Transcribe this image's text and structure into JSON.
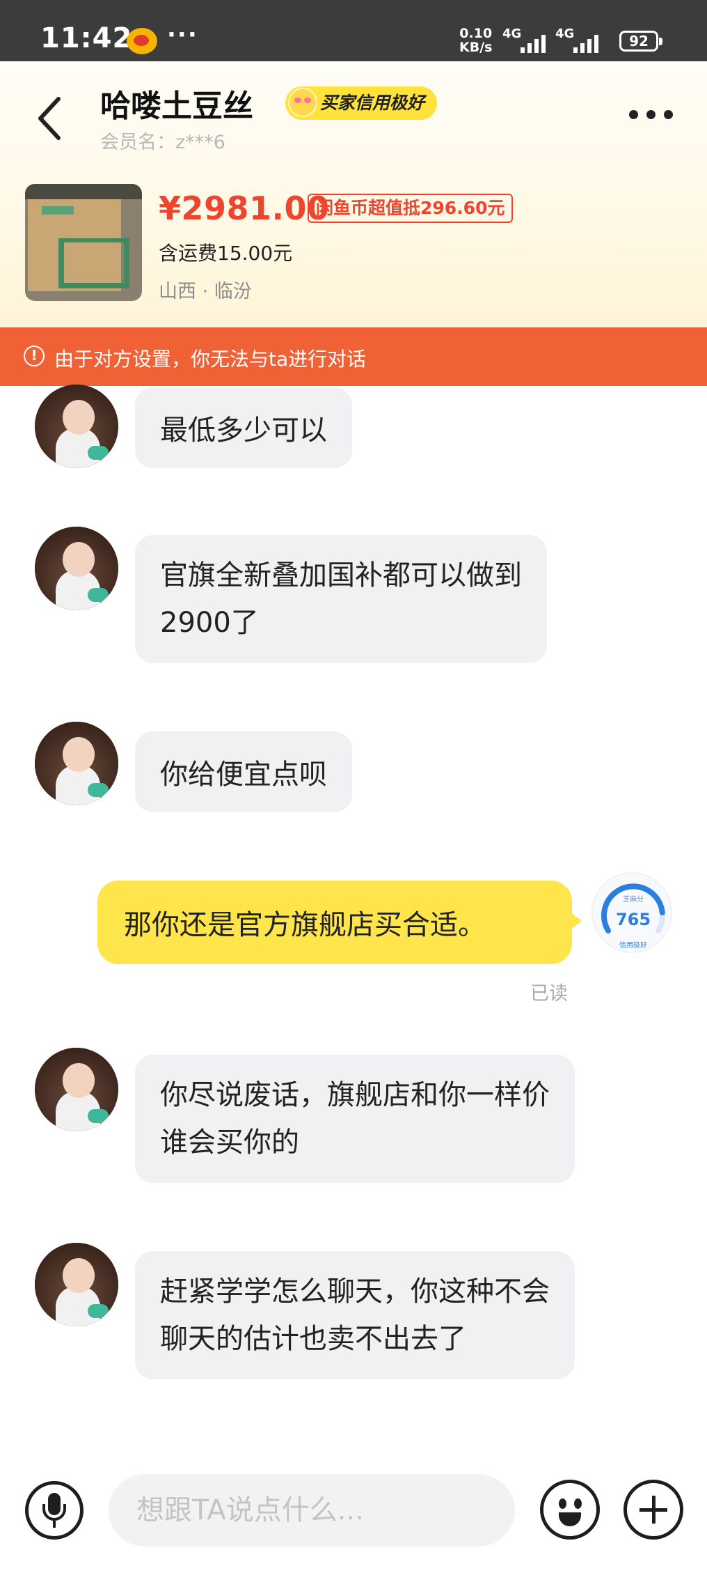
{
  "status_bar": {
    "time": "11:42",
    "net_speed_value": "0.10",
    "net_speed_unit": "KB/s",
    "signal_1": "4G",
    "signal_2": "4G",
    "battery": "92",
    "weibo_icon": "weibo-app-icon",
    "more": "···"
  },
  "header": {
    "seller_name": "哈喽土豆丝",
    "credit_badge": "买家信用极好",
    "member_id": "会员名：z***6"
  },
  "product": {
    "price": "¥2981.00",
    "coin_deduction": "闲鱼币超值抵296.60元",
    "shipping": "含运费15.00元",
    "location": "山西 · 临汾"
  },
  "notice": {
    "text": "由于对方设置，你无法与ta进行对话",
    "icon": "!"
  },
  "messages": {
    "m1": "最低多少可以",
    "m2_line1": "官旗全新叠加国补都可以做到",
    "m2_line2": "2900了",
    "m3": "你给便宜点呗",
    "m4": "那你还是官方旗舰店买合适。",
    "m4_read": "已读",
    "m5_line1": "你尽说废话，旗舰店和你一样价",
    "m5_line2": "谁会买你的",
    "m6_line1": "赶紧学学怎么聊天，你这种不会",
    "m6_line2": "聊天的估计也卖不出去了"
  },
  "credit_gauge": {
    "caption": "芝麻分",
    "score": "765",
    "grade": "信用极好"
  },
  "input": {
    "placeholder": "想跟TA说点什么..."
  },
  "colors": {
    "accent_yellow": "#ffe54c",
    "price_red": "#f0442e",
    "notice_orange": "#f06135"
  }
}
